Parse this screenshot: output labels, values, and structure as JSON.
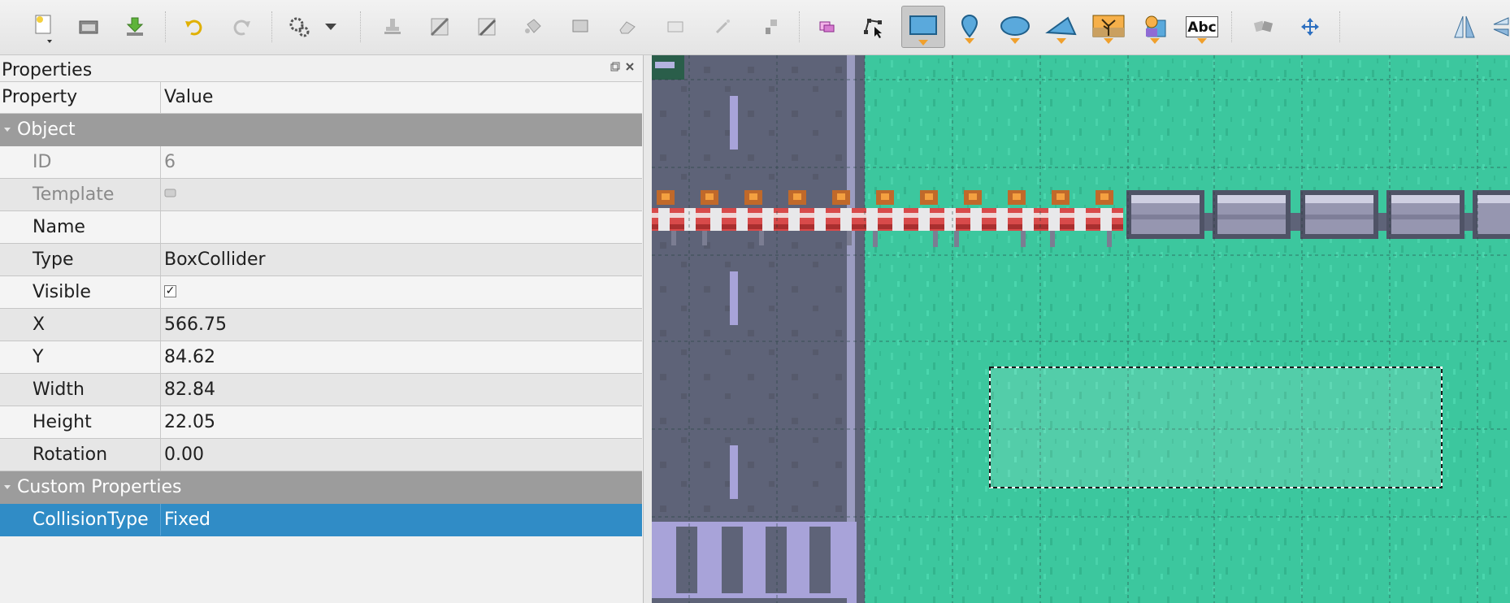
{
  "toolbar": {
    "tools": [
      {
        "name": "new-map",
        "icon": "new-document-icon"
      },
      {
        "name": "open",
        "icon": "folder-open-icon"
      },
      {
        "name": "save",
        "icon": "save-download-icon"
      },
      {
        "name": "undo",
        "icon": "undo-icon"
      },
      {
        "name": "redo",
        "icon": "redo-icon"
      },
      {
        "name": "commands",
        "icon": "gears-icon"
      },
      {
        "name": "stamp",
        "icon": "stamp-brush-icon"
      },
      {
        "name": "terrain",
        "icon": "terrain-brush-icon"
      },
      {
        "name": "wang",
        "icon": "wang-brush-icon"
      },
      {
        "name": "bucket-fill",
        "icon": "bucket-fill-icon"
      },
      {
        "name": "shape-fill",
        "icon": "shape-fill-icon"
      },
      {
        "name": "eraser",
        "icon": "eraser-icon"
      },
      {
        "name": "rect-select",
        "icon": "rectangle-select-icon"
      },
      {
        "name": "magic-wand",
        "icon": "magic-wand-icon"
      },
      {
        "name": "select-same",
        "icon": "select-same-tile-icon"
      },
      {
        "name": "select-objects",
        "icon": "select-objects-icon"
      },
      {
        "name": "edit-polygons",
        "icon": "edit-polygons-icon"
      },
      {
        "name": "insert-rectangle",
        "icon": "insert-rectangle-icon",
        "active": true
      },
      {
        "name": "insert-point",
        "icon": "insert-point-icon"
      },
      {
        "name": "insert-ellipse",
        "icon": "insert-ellipse-icon"
      },
      {
        "name": "insert-polygon",
        "icon": "insert-polygon-icon"
      },
      {
        "name": "insert-tile",
        "icon": "insert-tile-icon"
      },
      {
        "name": "insert-template",
        "icon": "insert-template-icon"
      },
      {
        "name": "insert-text",
        "icon": "insert-text-icon",
        "label": "Abc"
      },
      {
        "name": "random-mode",
        "icon": "dice-icon"
      },
      {
        "name": "move",
        "icon": "move-arrows-icon"
      },
      {
        "name": "flip-horizontal",
        "icon": "flip-horizontal-icon"
      }
    ]
  },
  "panel": {
    "title": "Properties",
    "columns": {
      "property": "Property",
      "value": "Value"
    },
    "groups": {
      "object": "Object",
      "custom": "Custom Properties"
    },
    "rows": [
      {
        "key": "ID",
        "value": "6"
      },
      {
        "key": "Template",
        "value": ""
      },
      {
        "key": "Name",
        "value": ""
      },
      {
        "key": "Type",
        "value": "BoxCollider"
      },
      {
        "key": "Visible",
        "value": "✓"
      },
      {
        "key": "X",
        "value": "566.75"
      },
      {
        "key": "Y",
        "value": "84.62"
      },
      {
        "key": "Width",
        "value": "82.84"
      },
      {
        "key": "Height",
        "value": "22.05"
      },
      {
        "key": "Rotation",
        "value": "0.00"
      }
    ],
    "custom_rows": [
      {
        "key": "CollisionType",
        "value": "Fixed"
      }
    ]
  },
  "map": {
    "colors": {
      "grass": "#3cc79e",
      "road": "#5e6378",
      "fence_red": "#d84a4a",
      "barrier": "#8e8fa8",
      "selection": "#1a1a1a"
    }
  }
}
